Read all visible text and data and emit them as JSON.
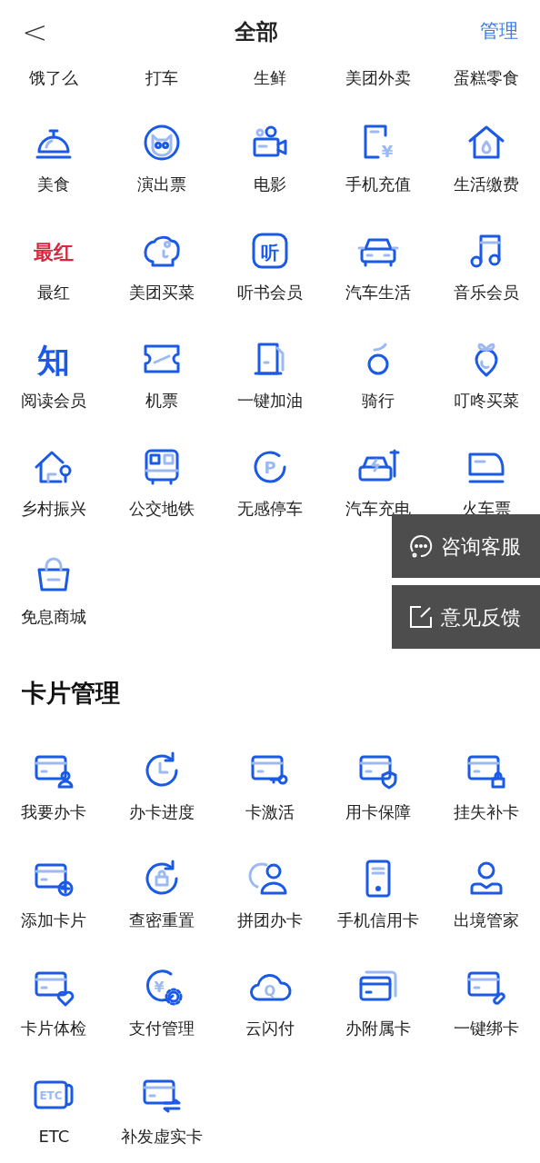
{
  "header": {
    "back": "<",
    "title": "全部",
    "action": "管理"
  },
  "top_row": [
    "饿了么",
    "打车",
    "生鲜",
    "美团外卖",
    "蛋糕零食"
  ],
  "services": [
    {
      "label": "美食"
    },
    {
      "label": "演出票"
    },
    {
      "label": "电影"
    },
    {
      "label": "手机充值",
      "glyph": "¥"
    },
    {
      "label": "生活缴费"
    },
    {
      "label": "最红",
      "glyph": "最红"
    },
    {
      "label": "美团买菜"
    },
    {
      "label": "听书会员",
      "glyph": "听"
    },
    {
      "label": "汽车生活"
    },
    {
      "label": "音乐会员"
    },
    {
      "label": "阅读会员",
      "glyph": "知"
    },
    {
      "label": "机票"
    },
    {
      "label": "一键加油"
    },
    {
      "label": "骑行"
    },
    {
      "label": "叮咚买菜"
    },
    {
      "label": "乡村振兴"
    },
    {
      "label": "公交地铁"
    },
    {
      "label": "无感停车",
      "glyph": "P"
    },
    {
      "label": "汽车充电"
    },
    {
      "label": "火车票"
    },
    {
      "label": "免息商城"
    }
  ],
  "card_section": {
    "title": "卡片管理",
    "items": [
      {
        "label": "我要办卡"
      },
      {
        "label": "办卡进度"
      },
      {
        "label": "卡激活"
      },
      {
        "label": "用卡保障"
      },
      {
        "label": "挂失补卡"
      },
      {
        "label": "添加卡片"
      },
      {
        "label": "查密重置"
      },
      {
        "label": "拼团办卡"
      },
      {
        "label": "手机信用卡"
      },
      {
        "label": "出境管家"
      },
      {
        "label": "卡片体检"
      },
      {
        "label": "支付管理",
        "glyph": "¥"
      },
      {
        "label": "云闪付",
        "glyph": "Q"
      },
      {
        "label": "办附属卡"
      },
      {
        "label": "一键绑卡"
      },
      {
        "label": "ETC",
        "glyph": "ETC"
      },
      {
        "label": "补发虚实卡"
      }
    ]
  },
  "floating_buttons": [
    {
      "kind": "chat",
      "label": "咨询客服"
    },
    {
      "kind": "feedback",
      "label": "意见反馈"
    }
  ]
}
